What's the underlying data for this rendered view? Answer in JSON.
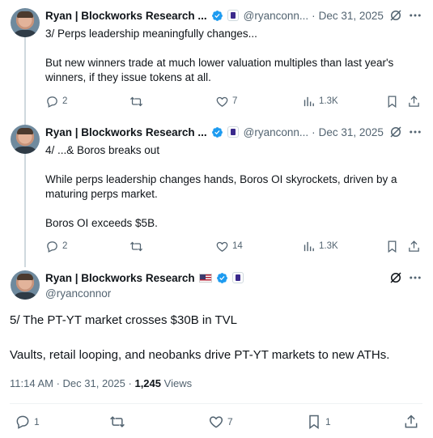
{
  "author": {
    "name": "Ryan | Blockworks Research ...",
    "full_name": "Ryan | Blockworks Research",
    "handle_truncated": "@ryanconn...",
    "handle": "@ryanconnor"
  },
  "posts": [
    {
      "date": "Dec 31, 2025",
      "lines": [
        "3/ Perps leadership meaningfully changes...",
        "",
        "But new winners trade at much lower valuation multiples than last year's winners, if they issue tokens at all."
      ],
      "replies": "2",
      "reposts": "",
      "likes": "7",
      "views": "1.3K"
    },
    {
      "date": "Dec 31, 2025",
      "lines": [
        "4/ ...& Boros breaks out",
        "",
        "While perps leadership changes hands, Boros OI skyrockets, driven by a maturing perps market.",
        "",
        "Boros OI exceeds $5B."
      ],
      "replies": "2",
      "reposts": "",
      "likes": "14",
      "views": "1.3K"
    }
  ],
  "main_post": {
    "lines": [
      "5/ The PT-YT market crosses $30B in TVL",
      "Vaults, retail looping, and neobanks drive PT-YT markets to new ATHs."
    ],
    "time": "11:14 AM",
    "date": "Dec 31, 2025",
    "views_count": "1,245",
    "views_label": "Views",
    "replies": "1",
    "reposts": "",
    "likes": "7",
    "bookmarks": "1"
  },
  "icons": {
    "verified": "verified-badge-icon",
    "org": "blockworks-org-badge-icon",
    "flag": "us-flag-icon",
    "grok": "grok-icon",
    "more": "more-icon",
    "reply": "reply-icon",
    "repost": "repost-icon",
    "like": "heart-icon",
    "views": "views-icon",
    "bookmark": "bookmark-icon",
    "share": "share-icon"
  },
  "colors": {
    "text": "#0f1419",
    "secondary": "#536471",
    "verified": "#1d9bf0",
    "thread_line": "#cfd9de"
  }
}
